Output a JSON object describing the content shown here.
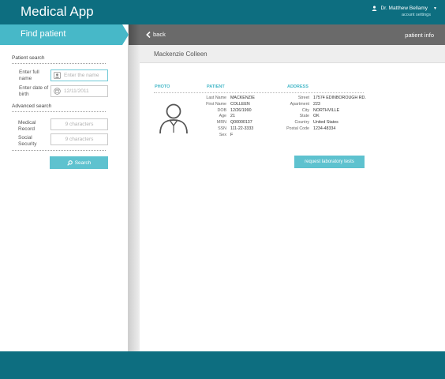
{
  "app": {
    "title": "Medical App"
  },
  "user": {
    "name": "Dr. Matthew Bellamy",
    "account_link": "acount settings"
  },
  "sidebar": {
    "title": "Find patient",
    "patient_search": {
      "heading": "Patient search",
      "name_label": "Enter full name",
      "name_placeholder": "Enter the name",
      "dob_label": "Enter date of birth",
      "dob_placeholder": "12/11/2011"
    },
    "advanced_search": {
      "heading": "Advanced search",
      "medical_label": "Medical Record",
      "medical_placeholder": "9 characters",
      "social_label": "Social Security",
      "social_placeholder": "9 characters"
    },
    "search_button": "Search"
  },
  "main": {
    "back_label": "back",
    "panel_title": "patient info",
    "patient_name": "Mackenzie Colleen",
    "columns": {
      "photo": "PHOTO",
      "patient": "PATIENT",
      "address": "ADDRESS"
    },
    "patient_fields": [
      {
        "label": "Last Name",
        "value": "MACKENZIE"
      },
      {
        "label": "First Name",
        "value": "COLLEEN"
      },
      {
        "label": "DOB",
        "value": "12/26/1990"
      },
      {
        "label": "Age",
        "value": "21"
      },
      {
        "label": "MRN",
        "value": "Q00000137"
      },
      {
        "label": "SSN",
        "value": "111-22-3333"
      },
      {
        "label": "Sex",
        "value": "F"
      }
    ],
    "address_fields": [
      {
        "label": "Street",
        "value": "17574 EDINBOROUGH RD."
      },
      {
        "label": "Apartment",
        "value": "223"
      },
      {
        "label": "City",
        "value": "NORTHVILLE"
      },
      {
        "label": "State",
        "value": "OK"
      },
      {
        "label": "Country",
        "value": "United States"
      },
      {
        "label": "Postal Code",
        "value": "1234-48334"
      }
    ],
    "lab_button": "request laboratory tests"
  },
  "colors": {
    "header": "#0d6e80",
    "accent": "#47b8c8",
    "button": "#5ec2cf",
    "panel_bar": "#6a6a6a"
  },
  "icons": [
    "person-icon",
    "caret-down-icon",
    "user-field-icon",
    "calendar-icon",
    "search-icon",
    "chevron-left-icon",
    "avatar-icon"
  ]
}
